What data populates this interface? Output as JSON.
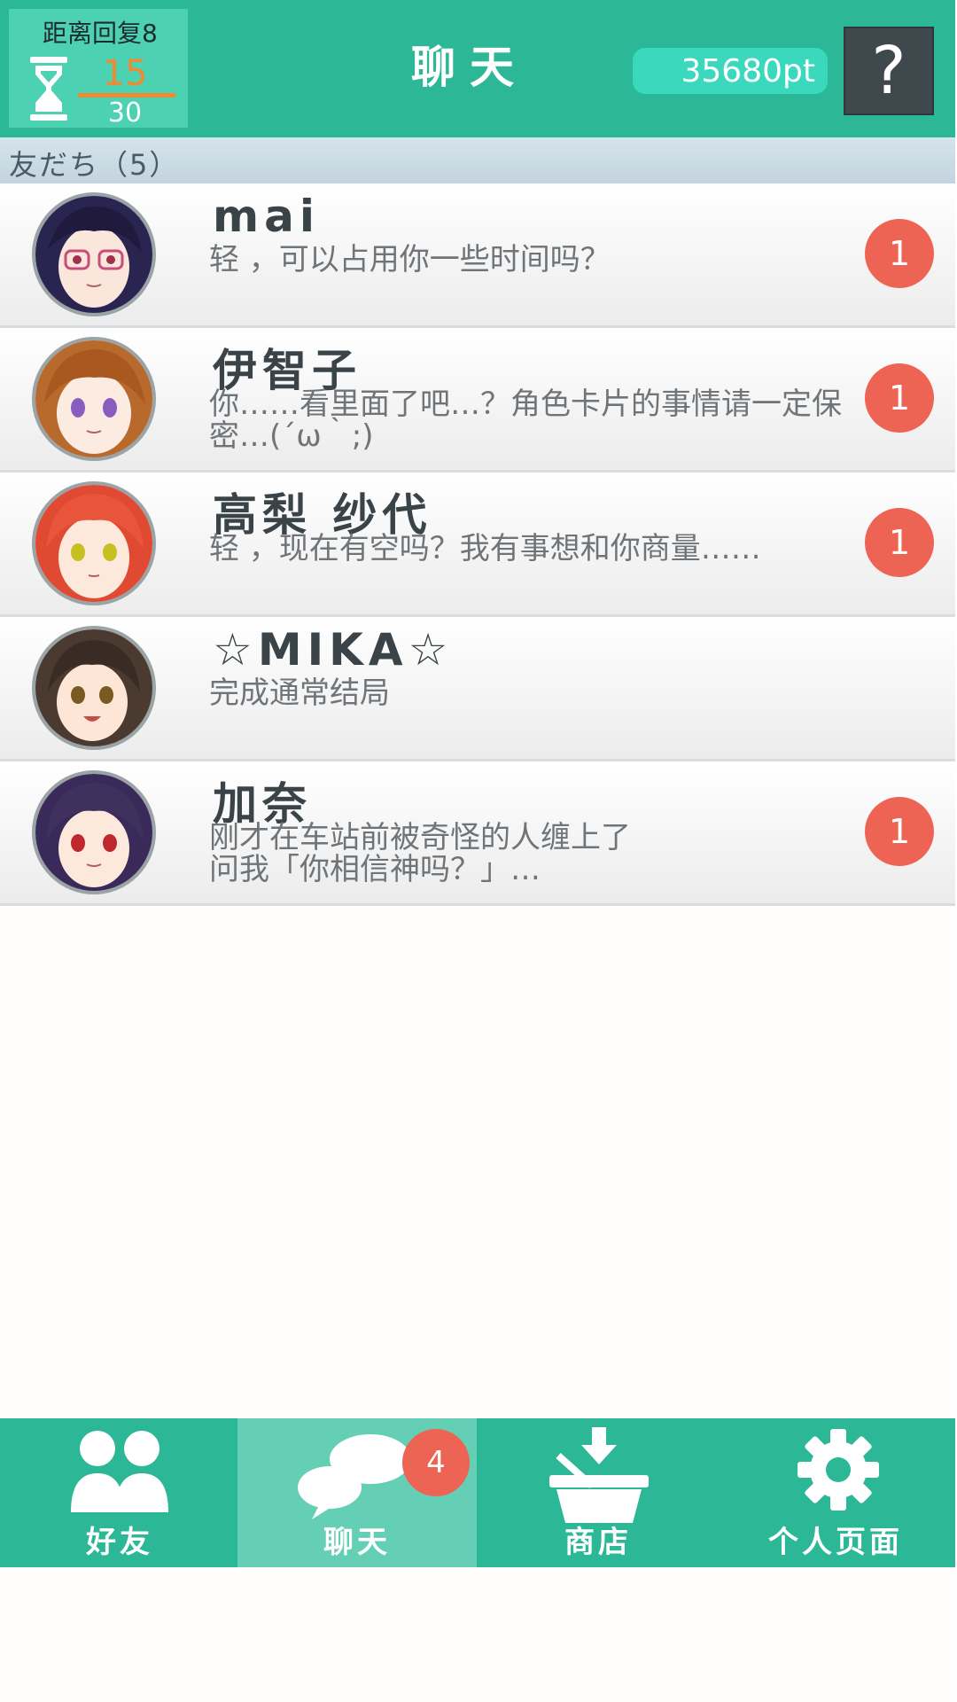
{
  "header": {
    "stamina_label": "距离回复8",
    "stamina_current": "15",
    "stamina_max": "30",
    "title": "聊天",
    "points": "35680pt",
    "help_glyph": "?"
  },
  "section": {
    "label": "友だち（5）"
  },
  "chats": [
    {
      "name": "mai",
      "message": "轻 ，可以占用你一些时间吗？",
      "badge": "1"
    },
    {
      "name": "伊智子",
      "message": "你……看里面了吧…？角色卡片的事情请一定保\n密…(´ω｀;)",
      "badge": "1"
    },
    {
      "name": "高梨 纱代",
      "message": "轻 ，现在有空吗？我有事想和你商量……",
      "badge": "1"
    },
    {
      "name": "☆MIKA☆",
      "message": "完成通常结局",
      "badge": ""
    },
    {
      "name": "加奈",
      "message": "刚才在车站前被奇怪的人缠上了\n问我「你相信神吗？」…",
      "badge": "1"
    }
  ],
  "nav": {
    "items": [
      {
        "label": "好友",
        "icon": "friends-icon"
      },
      {
        "label": "聊天",
        "icon": "chat-bubbles-icon"
      },
      {
        "label": "商店",
        "icon": "shop-basket-icon"
      },
      {
        "label": "个人页面",
        "icon": "gear-icon"
      }
    ],
    "chat_badge": "4"
  },
  "colors": {
    "primary": "#2cb896",
    "badge": "#ee6454",
    "accent_orange": "#f08a30",
    "dark_button": "#3f494d"
  }
}
